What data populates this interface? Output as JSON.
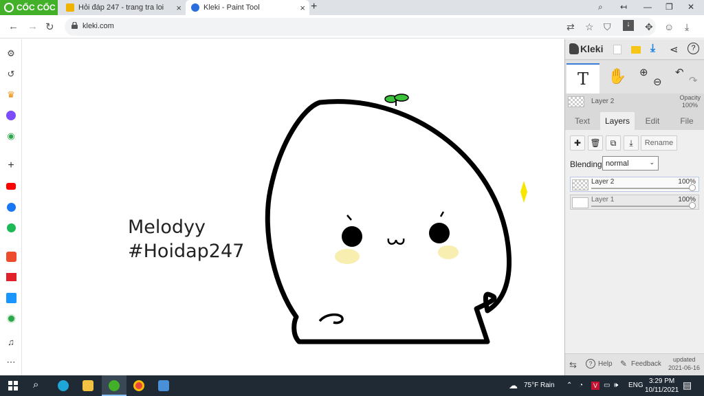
{
  "browser": {
    "brand": "CỐC CỐC",
    "tabs": [
      {
        "title": "Hỏi đáp 247 - trang tra loi",
        "active": false
      },
      {
        "title": "Kleki - Paint Tool",
        "active": true
      }
    ],
    "url": "kleki.com"
  },
  "canvas": {
    "text_line1": "Melodyy",
    "text_line2": "#Hoidap247"
  },
  "kleki": {
    "app_name": "Kleki",
    "current_layer": "Layer 2",
    "opacity_label": "Opacity",
    "opacity_value": "100%",
    "tabs": [
      "Text",
      "Layers",
      "Edit",
      "File"
    ],
    "active_tab": "Layers",
    "rename_label": "Rename",
    "blending_label": "Blending",
    "blending_value": "normal",
    "layers": [
      {
        "name": "Layer 2",
        "opacity": "100%",
        "selected": true
      },
      {
        "name": "Layer 1",
        "opacity": "100%",
        "selected": false
      }
    ],
    "footer": {
      "help": "Help",
      "feedback": "Feedback",
      "updated_label": "updated",
      "updated_date": "2021-06-16"
    }
  },
  "taskbar": {
    "weather": "75°F Rain",
    "language": "ENG",
    "time": "3:29 PM",
    "date": "10/11/2021"
  },
  "colors": {
    "brand_green": "#43b02a",
    "accent_blue": "#3a7bd5",
    "taskbar": "#1f2a35"
  }
}
